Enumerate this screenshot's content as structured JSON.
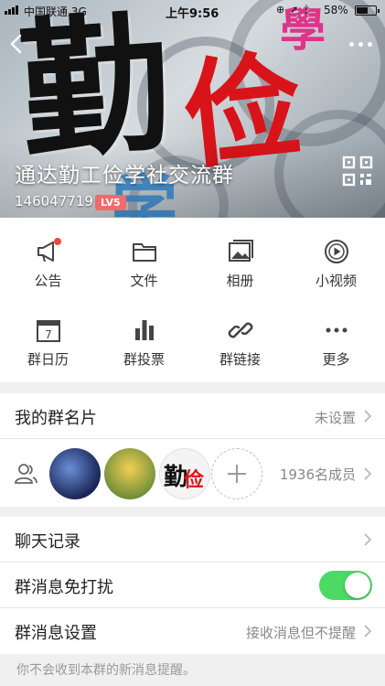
{
  "status_bar": {
    "carrier": "中国联通",
    "network": "3G",
    "time": "上午9:56",
    "battery": "58%",
    "battery_level": 0.58
  },
  "header": {
    "back_icon": "chevron-left-icon",
    "more_icon": "more-horizontal-icon",
    "group_name": "通达勤工俭学社交流群",
    "group_id": "146047719",
    "level_badge": "LV5",
    "qr_icon": "qr-code-icon",
    "banner_text": {
      "char_1": "勤",
      "char_2": "俭",
      "char_3": "学",
      "char_4": "學"
    },
    "colors": {
      "char_1": "#111111",
      "char_2": "#d8141a",
      "char_3": "#3c8fd6",
      "char_4": "#e0338a",
      "badge": "#f26a6a"
    }
  },
  "features": [
    {
      "label": "公告",
      "icon": "megaphone-icon",
      "has_dot": true
    },
    {
      "label": "文件",
      "icon": "folder-icon",
      "has_dot": false
    },
    {
      "label": "相册",
      "icon": "photo-album-icon",
      "has_dot": false
    },
    {
      "label": "小视频",
      "icon": "video-play-icon",
      "has_dot": false
    },
    {
      "label": "群日历",
      "icon": "calendar-icon",
      "calendar_day": "7",
      "has_dot": false
    },
    {
      "label": "群投票",
      "icon": "bar-chart-icon",
      "has_dot": false
    },
    {
      "label": "群链接",
      "icon": "link-icon",
      "has_dot": false
    },
    {
      "label": "更多",
      "icon": "more-horizontal-icon",
      "has_dot": false
    }
  ],
  "profile": {
    "card_label": "我的群名片",
    "card_value": "未设置",
    "members_icon": "members-icon",
    "member_count": "1936名成员",
    "avatar_3_text_1": "勤",
    "avatar_3_text_2": "俭"
  },
  "settings": {
    "chat_history_label": "聊天记录",
    "do_not_disturb_label": "群消息免打扰",
    "do_not_disturb_on": true,
    "message_settings_label": "群消息设置",
    "message_settings_value": "接收消息但不提醒"
  },
  "footnote": "你不会收到本群的新消息提醒。",
  "accent_colors": {
    "toggle_on": "#4cd964",
    "notification_dot": "#ef4a3c"
  }
}
